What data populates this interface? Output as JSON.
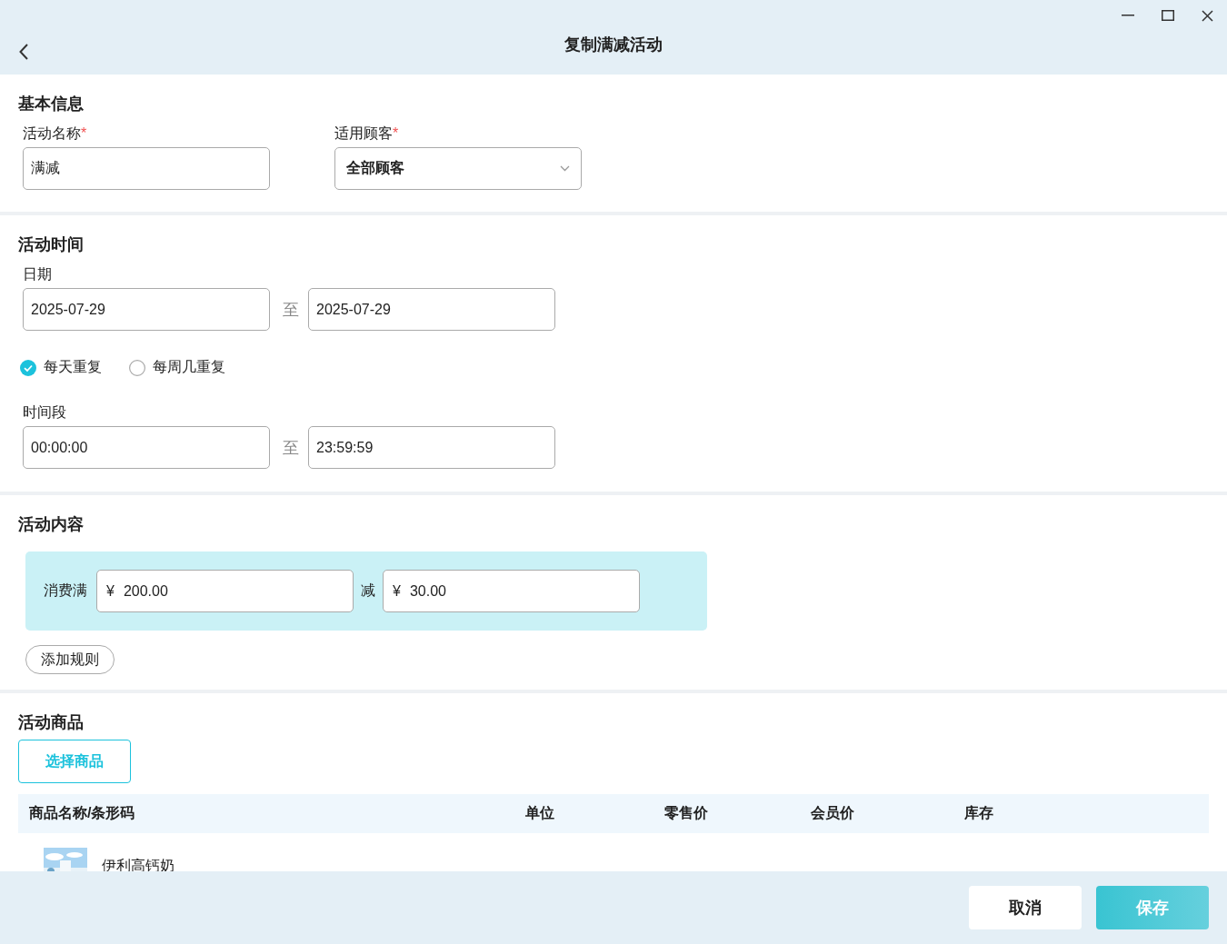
{
  "window": {
    "title": "复制满减活动"
  },
  "basic_info": {
    "heading": "基本信息",
    "fields": [
      {
        "label": "活动名称",
        "required_mark": "*",
        "kind": "text",
        "value": "满减"
      },
      {
        "label": "适用顾客",
        "required_mark": "*",
        "kind": "select",
        "value": "全部顾客"
      }
    ]
  },
  "activity_time": {
    "heading": "活动时间",
    "date": {
      "label": "日期",
      "start": "2025-07-29",
      "separator": "至",
      "end": "2025-07-29"
    },
    "repeat_options": [
      {
        "label": "每天重复",
        "selected": true
      },
      {
        "label": "每周几重复",
        "selected": false
      }
    ],
    "time_range": {
      "label": "时间段",
      "start": "00:00:00",
      "separator": "至",
      "end": "23:59:59"
    }
  },
  "activity_content": {
    "heading": "活动内容",
    "rules": [
      {
        "threshold_label": "消费满",
        "threshold_currency": "¥",
        "threshold": "200.00",
        "discount_label": "减",
        "discount_currency": "¥",
        "discount": "30.00"
      }
    ],
    "add_rule_button": "添加规则"
  },
  "products": {
    "heading": "活动商品",
    "select_button": "选择商品",
    "table": {
      "columns": [
        "商品名称/条形码",
        "单位",
        "零售价",
        "会员价",
        "库存"
      ],
      "rows": [
        {
          "name": "伊利高钙奶"
        }
      ]
    }
  },
  "footer": {
    "buttons": [
      {
        "label": "取消",
        "kind": "secondary"
      },
      {
        "label": "保存",
        "kind": "primary"
      }
    ]
  }
}
